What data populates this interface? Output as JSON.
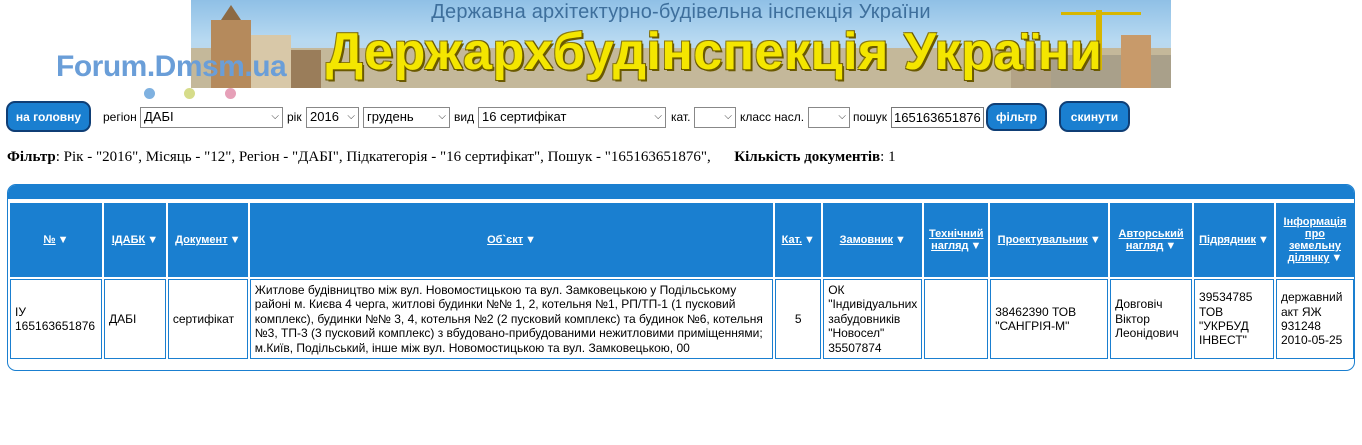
{
  "banner": {
    "subtitle": "Державна архітектурно-будівельна інспекція України",
    "title": "Держархбудінспекція України"
  },
  "watermark": "Forum.Dmsm.ua",
  "filters": {
    "home_button": "на головну",
    "region_label": "регіон",
    "region_value": "ДАБІ",
    "year_label": "рік",
    "year_value": "2016",
    "month_value": "грудень",
    "type_label": "вид",
    "type_value": "16 сертифікат",
    "cat_label": "кат.",
    "cat_value": "",
    "class_label": "класс насл.",
    "class_value": "",
    "search_label": "пошук",
    "search_value": "165163651876",
    "filter_button": "фільтр",
    "reset_button": "скинути"
  },
  "summary": {
    "filter_label": "Фільтр",
    "filter_text": ": Рік - \"2016\", Місяць - \"12\", Регіон - \"ДАБІ\", Підкатегорія - \"16 сертифікат\", Пошук - \"165163651876\",",
    "count_label": "Кількість документів",
    "count_text": ": 1"
  },
  "table": {
    "headers": [
      "№",
      "ІДАБК",
      "Документ",
      "Об`єкт",
      "Кат.",
      "Замовник",
      "Технічний нагляд",
      "Проектувальник",
      "Авторський нагляд",
      "Підрядник",
      "Інформація про земельну ділянку"
    ],
    "rows": [
      {
        "number": "ІУ 165163651876",
        "idabk": "ДАБІ",
        "document": "сертифікат",
        "object": "Житлове будівництво між вул. Новомостицькою та вул. Замковецькою у Подільському районі м. Києва 4 черга, житлові будинки №№ 1, 2, котельня №1, РП/ТП-1 (1 пусковий комплекс), будинки №№ 3, 4, котельня №2 (2 пусковий комплекс) та будинок №6, котельня №3, ТП-3 (3 пусковий комплекс) з вбудовано-прибудованими нежитловими приміщеннями; м.Київ, Подільський, інше між вул. Новомостицькою та вул. Замковецькою, 00",
        "category": "5",
        "customer": "ОК \"Індивідуальних забудовників \"Новосел\" 35507874",
        "tech_supervision": "",
        "designer": "38462390 ТОВ \"САНГРІЯ-М\"",
        "author_supervision": "Довговіч Віктор Леонідович",
        "contractor": "39534785 ТОВ \"УКРБУД ІНВЕСТ\"",
        "land_info": "державний акт ЯЖ 931248 2010-05-25"
      }
    ]
  },
  "colors": {
    "accent": "#1a7fd0",
    "banner_title": "#f4e600",
    "dots": [
      "#7fb1e0",
      "#d6dc8a",
      "#e6a0b8"
    ]
  }
}
